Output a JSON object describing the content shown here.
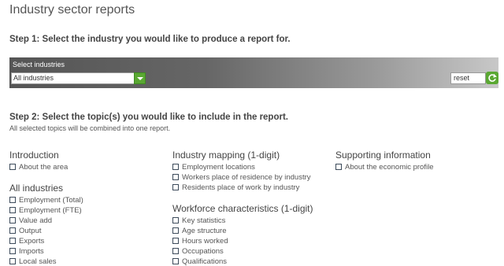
{
  "page": {
    "title": "Industry sector reports"
  },
  "step1": {
    "heading": "Step 1: Select the industry you would like to produce a report for.",
    "select_label": "Select industries",
    "select_value": "All industries",
    "reset_value": "reset"
  },
  "step2": {
    "heading": "Step 2: Select the topic(s) you would like to include in the report.",
    "subtext": "All selected topics will be combined into one report."
  },
  "topics": {
    "introduction": {
      "title": "Introduction",
      "items": [
        "About the area"
      ]
    },
    "all_industries": {
      "title": "All industries",
      "items": [
        "Employment (Total)",
        "Employment (FTE)",
        "Value add",
        "Output",
        "Exports",
        "Imports",
        "Local sales"
      ]
    },
    "industry_mapping": {
      "title": "Industry mapping (1-digit)",
      "items": [
        "Employment locations",
        "Workers place of residence by industry",
        "Residents place of work by industry"
      ]
    },
    "workforce": {
      "title": "Workforce characteristics (1-digit)",
      "items": [
        "Key statistics",
        "Age structure",
        "Hours worked",
        "Occupations",
        "Qualifications"
      ]
    },
    "supporting": {
      "title": "Supporting information",
      "items": [
        "About the economic profile"
      ]
    }
  },
  "colors": {
    "accent_green": "#5aa832",
    "checkbox_border": "#3c4a5a"
  },
  "icons": {
    "dropdown": "chevron-down-icon",
    "reset": "refresh-icon"
  }
}
